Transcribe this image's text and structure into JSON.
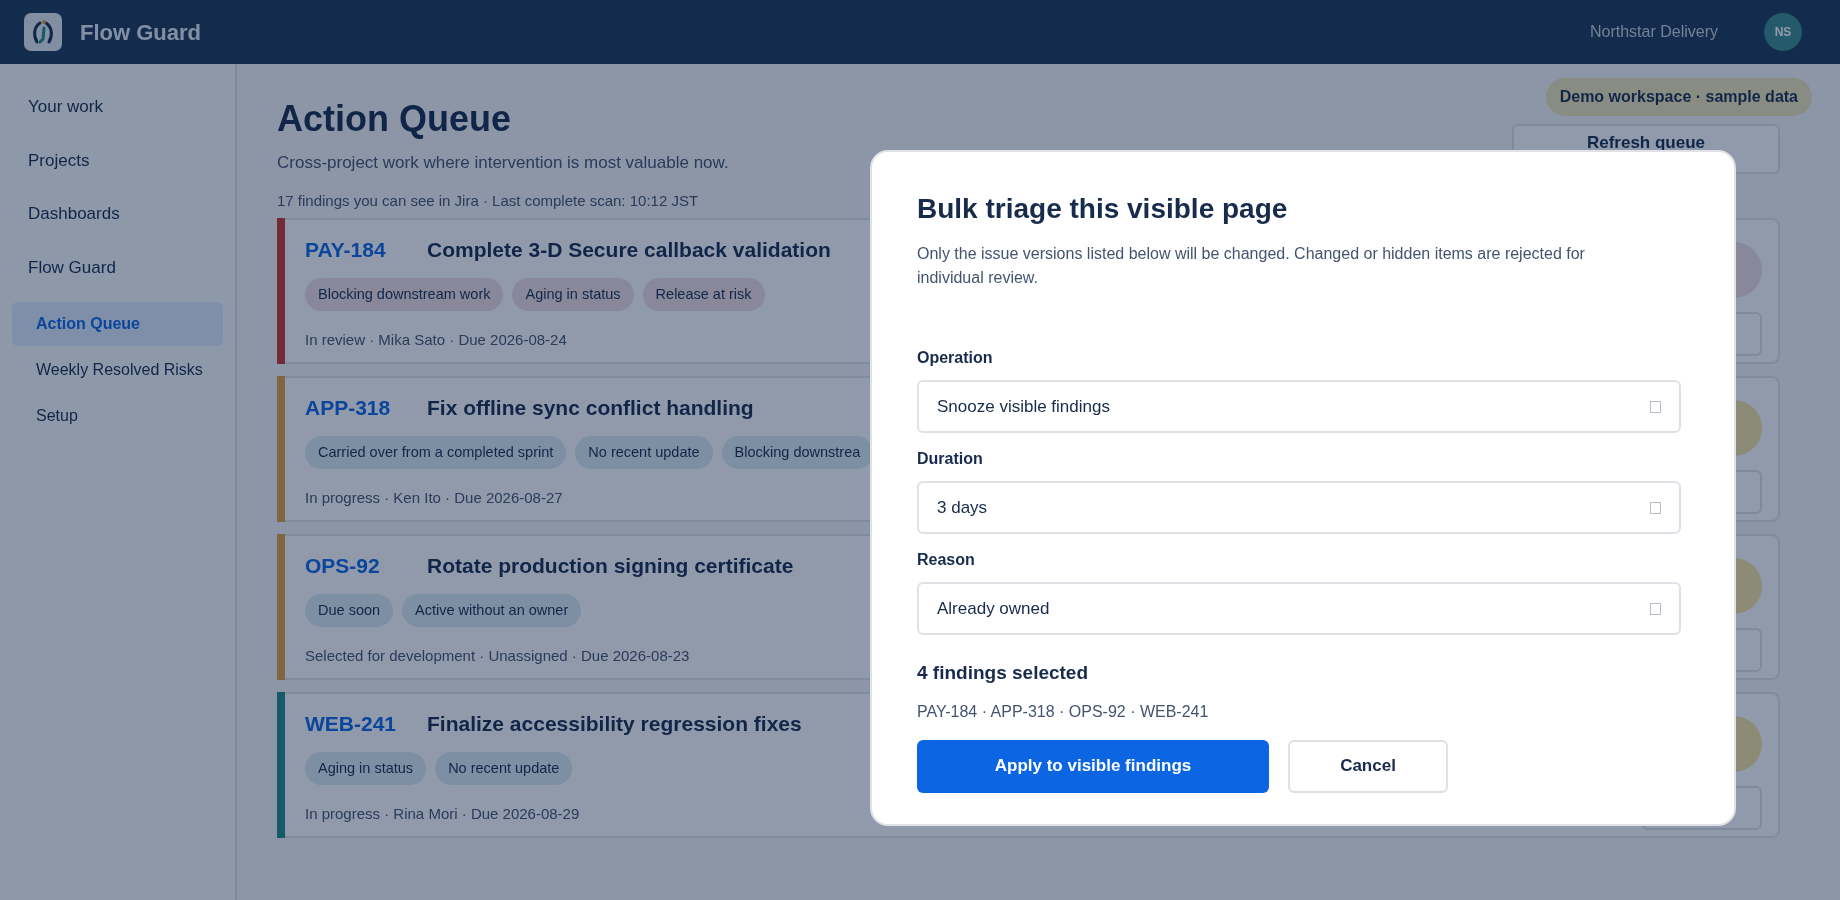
{
  "top_bar": {
    "app_name": "Flow Guard",
    "workspace": "Northstar Delivery",
    "avatar_initials": "NS"
  },
  "sidebar": {
    "items": [
      {
        "label": "Your work",
        "selected": false
      },
      {
        "label": "Projects",
        "selected": false
      },
      {
        "label": "Dashboards",
        "selected": false
      },
      {
        "label": "Flow Guard",
        "selected": false,
        "children": [
          {
            "label": "Action Queue",
            "selected": true
          },
          {
            "label": "Weekly Resolved Risks",
            "selected": false
          },
          {
            "label": "Setup",
            "selected": false
          }
        ]
      }
    ]
  },
  "page": {
    "title": "Action Queue",
    "subtitle": "Cross-project work where intervention is most valuable now.",
    "meta": "17 findings you can see in Jira · Last complete scan: 10:12 JST",
    "badge": "Demo workspace · sample data",
    "refresh_button": "Refresh queue"
  },
  "findings": [
    {
      "key": "PAY-184",
      "title": "Complete 3-D Secure callback validation",
      "kind": "critical",
      "tags": [
        "Blocking downstream work",
        "Aging in status",
        "Release at risk"
      ],
      "meta": "In review · Mika Sato · Due 2026-08-24"
    },
    {
      "key": "APP-318",
      "title": "Fix offline sync conflict handling",
      "kind": "warning",
      "tags": [
        "Carried over from a completed sprint",
        "No recent update",
        "Blocking downstrea"
      ],
      "meta": "In progress · Ken Ito · Due 2026-08-27"
    },
    {
      "key": "OPS-92",
      "title": "Rotate production signing certificate",
      "kind": "warning",
      "tags": [
        "Due soon",
        "Active without an owner"
      ],
      "meta": "Selected for development · Unassigned · Due 2026-08-23"
    },
    {
      "key": "WEB-241",
      "title": "Finalize accessibility regression fixes",
      "kind": "info",
      "tags": [
        "Aging in status",
        "No recent update"
      ],
      "meta": "In progress · Rina Mori · Due 2026-08-29"
    }
  ],
  "dialog": {
    "title": "Bulk triage this visible page",
    "description": "Only the issue versions listed below will be changed. Changed or hidden items are rejected for individual review.",
    "fields": [
      {
        "label": "Operation",
        "value": "Snooze visible findings"
      },
      {
        "label": "Duration",
        "value": "3 days"
      },
      {
        "label": "Reason",
        "value": "Already owned"
      }
    ],
    "selection_title": "4 findings selected",
    "selected_keys": "PAY-184 · APP-318 · OPS-92 · WEB-241",
    "buttons": [
      {
        "label": "Apply to visible findings",
        "kind": "primary"
      },
      {
        "label": "Cancel",
        "kind": "secondary"
      }
    ]
  }
}
